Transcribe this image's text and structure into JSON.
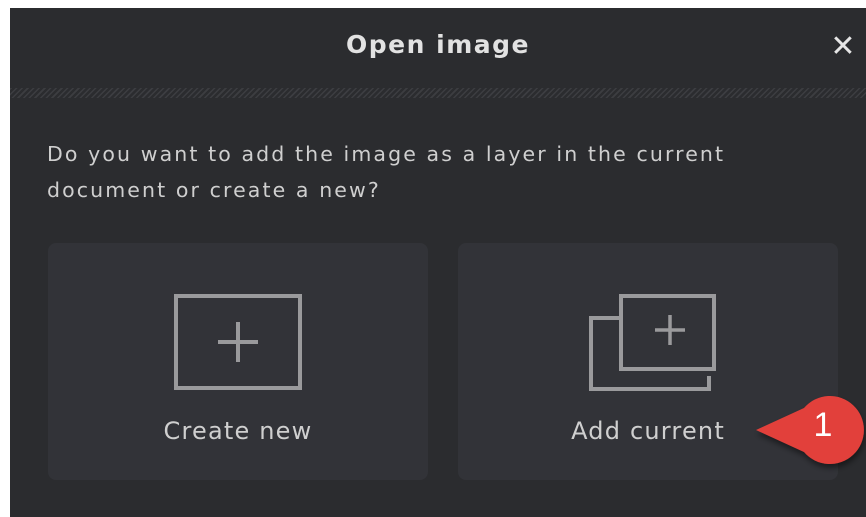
{
  "dialog": {
    "title": "Open image",
    "close_glyph": "✕",
    "question": "Do you want to add the image as a layer in the current document or create a new?",
    "options": [
      {
        "label": "Create new",
        "icon": "new-document-plus-icon"
      },
      {
        "label": "Add current",
        "icon": "add-layer-stacked-plus-icon"
      }
    ]
  },
  "annotation": {
    "callout_number": "1",
    "callout_color": "#e2403a"
  },
  "colors": {
    "dialog_bg": "#2b2c2f",
    "option_bg": "#323338",
    "icon_stroke": "#9a9a9c",
    "text": "#cfcfcf"
  }
}
